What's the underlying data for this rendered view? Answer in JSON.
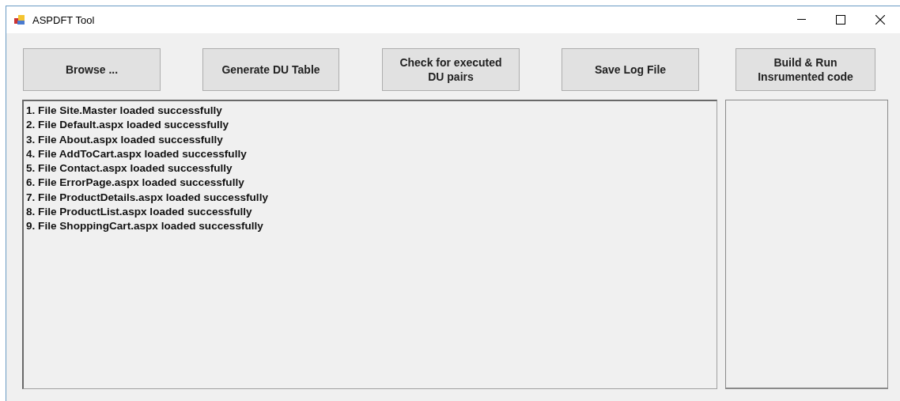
{
  "window": {
    "title": "ASPDFT Tool"
  },
  "buttons": [
    {
      "label": "Browse ..."
    },
    {
      "label": "Generate DU Table"
    },
    {
      "label": "Check for executed\nDU pairs"
    },
    {
      "label": "Save Log File"
    },
    {
      "label": "Build & Run\nInsrumented code"
    }
  ],
  "log": [
    "1. File Site.Master loaded successfully",
    "2. File Default.aspx loaded successfully",
    "3. File About.aspx loaded successfully",
    "4. File AddToCart.aspx loaded successfully",
    "5. File Contact.aspx loaded successfully",
    "6. File ErrorPage.aspx loaded successfully",
    "7. File ProductDetails.aspx loaded successfully",
    "8. File ProductList.aspx loaded successfully",
    "9. File ShoppingCart.aspx loaded successfully"
  ]
}
